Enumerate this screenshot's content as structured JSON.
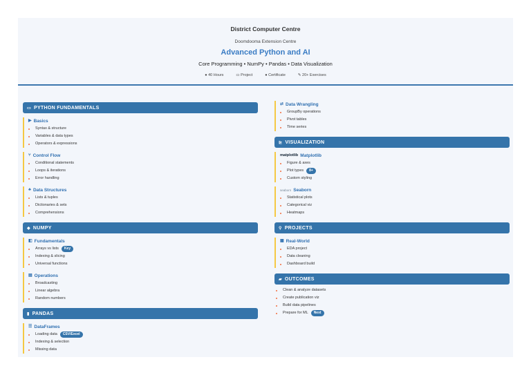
{
  "header": {
    "org": "District Computer Centre",
    "branch": "Doomdooma Extension Centre",
    "title": "Advanced Python and AI",
    "subtitle": "Core Programming • NumPy • Pandas • Data Visualization",
    "meta": [
      "40 Hours",
      "Project",
      "Certificate",
      "20+ Exercises"
    ]
  },
  "left": {
    "python": {
      "title": "PYTHON FUNDAMENTALS",
      "basics": {
        "title": "Basics",
        "items": [
          "Syntax & structure",
          "Variables & data types",
          "Operators & expressions"
        ]
      },
      "control": {
        "title": "Control Flow",
        "items": [
          "Conditional statements",
          "Loops & iterations",
          "Error handling"
        ]
      },
      "ds": {
        "title": "Data Structures",
        "items": [
          "Lists & tuples",
          "Dictionaries & sets",
          "Comprehensions"
        ]
      }
    },
    "numpy": {
      "title": "NUMPY",
      "fund": {
        "title": "Fundamentals",
        "items": [
          "Arrays vs lists",
          "Indexing & slicing",
          "Universal functions"
        ],
        "badge": "Key"
      },
      "ops": {
        "title": "Operations",
        "items": [
          "Broadcasting",
          "Linear algebra",
          "Random numbers"
        ]
      }
    },
    "pandas": {
      "title": "PANDAS",
      "df": {
        "title": "DataFrames",
        "items": [
          "Loading data",
          "Indexing & selection",
          "Missing data"
        ],
        "badge": "CSV/Excel"
      }
    }
  },
  "right": {
    "wrangling": {
      "title": "Data Wrangling",
      "items": [
        "GroupBy operations",
        "Pivot tables",
        "Time series"
      ]
    },
    "viz": {
      "title": "VISUALIZATION",
      "mpl": {
        "logo": "matplotlib",
        "title": "Matplotlib",
        "items": [
          "Figure & axes",
          "Plot types",
          "Custom styling"
        ],
        "badge": "8+"
      },
      "sns": {
        "logo": "seaborn",
        "title": "Seaborn",
        "items": [
          "Statistical plots",
          "Categorical viz",
          "Heatmaps"
        ]
      }
    },
    "projects": {
      "title": "PROJECTS",
      "rw": {
        "title": "Real-World",
        "items": [
          "EDA project",
          "Data cleaning",
          "Dashboard build"
        ]
      }
    },
    "outcomes": {
      "title": "OUTCOMES",
      "items": [
        "Clean & analyze datasets",
        "Create publication viz",
        "Build data pipelines",
        "Prepare for ML"
      ],
      "badge": "Next"
    }
  }
}
